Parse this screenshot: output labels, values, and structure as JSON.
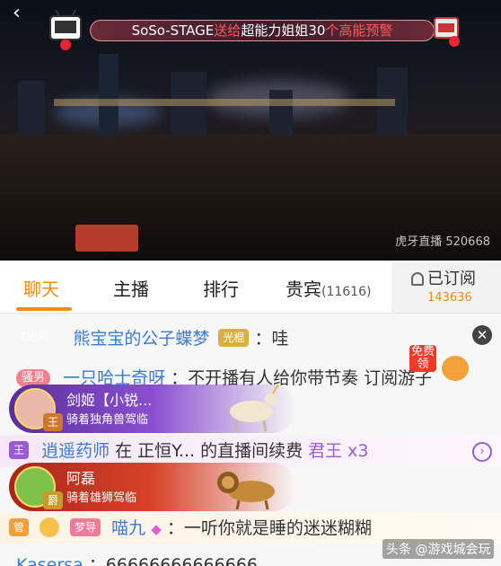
{
  "banner": {
    "sender": "SoSo-STAGE",
    "verb": "送给",
    "receiver": "超能力姐姐30",
    "suffix": "个高能预警"
  },
  "video": {
    "watermark": "虎牙直播 520668"
  },
  "tabs": [
    {
      "label": "聊天"
    },
    {
      "label": "主播"
    },
    {
      "label": "排行"
    },
    {
      "label": "贵宾",
      "count": "(11616)"
    }
  ],
  "subscribe": {
    "label": "已订阅",
    "count": "143636"
  },
  "chat": {
    "row1": {
      "badge": "Db熊",
      "name": "熊宝宝的公子蝶梦",
      "tag": "光棍",
      "text": "：哇"
    },
    "row2": {
      "badge": "骚男",
      "name": "一只哈士奇呀",
      "text": "：不开播有人给你带节奏  订阅游子"
    },
    "row3": {
      "badge": "王",
      "name": "逍遥药师",
      "text1": " 在 ",
      "anchor": "正恒Y...",
      "text2": " 的直播间续费 ",
      "tier": "君王 x3"
    },
    "row4": {
      "badge": "管",
      "lvl": "梦导",
      "name": "喵九",
      "text": "：一听你就是睡的迷迷糊糊"
    },
    "row5": {
      "name": "Kasersa",
      "text": "：66666666666666"
    }
  },
  "gift_cards": [
    {
      "name": "剑姬【小锐...",
      "desc": "骑着独角兽驾临",
      "rank": "王",
      "color": "#6a3fb0"
    },
    {
      "name": "阿磊",
      "desc": "骑着雄狮驾临",
      "rank": "爵",
      "color": "#c8311e"
    }
  ],
  "free_gift": {
    "label": "免费领"
  },
  "corner_watermark": "头条 @游戏城会玩",
  "colors": {
    "accent": "#f08a1a",
    "name_blue": "#3a7bd5"
  }
}
